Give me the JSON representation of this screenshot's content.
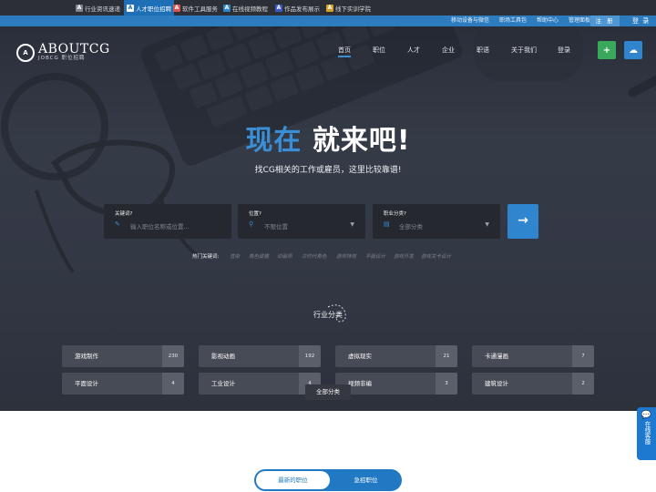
{
  "top_sites": [
    {
      "label": "行业资讯速递",
      "color": "#7d8591",
      "glyph": "A",
      "active": false
    },
    {
      "label": "人才职位招聘",
      "color": "#1d6fb8",
      "glyph": "A",
      "active": true
    },
    {
      "label": "软件工具服务",
      "color": "#d9534f",
      "glyph": "A",
      "active": false
    },
    {
      "label": "在线视频教程",
      "color": "#2e86c9",
      "glyph": "A",
      "active": false
    },
    {
      "label": "作品发布展示",
      "color": "#3b58c4",
      "glyph": "A",
      "active": false
    },
    {
      "label": "线下实训学院",
      "color": "#d6a12b",
      "glyph": "A",
      "active": false
    }
  ],
  "sub_links": [
    "移动设备与微信",
    "职场工具包",
    "帮助中心",
    "管理面板"
  ],
  "register_label": "注 册",
  "login_label": "登 录",
  "logo": {
    "title": "ABOUTCG",
    "subtitle": "JOBCG 职位招聘"
  },
  "nav": [
    {
      "label": "首页",
      "active": true
    },
    {
      "label": "职位",
      "active": false
    },
    {
      "label": "人才",
      "active": false
    },
    {
      "label": "企业",
      "active": false
    },
    {
      "label": "职语",
      "active": false
    },
    {
      "label": "关于我们",
      "active": false
    },
    {
      "label": "登录",
      "active": false
    }
  ],
  "header_buttons": [
    {
      "icon": "plus-icon",
      "glyph": "+",
      "color": "#3aa85a"
    },
    {
      "icon": "cloud-icon",
      "glyph": "☁",
      "color": "#2f86cf"
    }
  ],
  "hero": {
    "headline_blue": "现在",
    "headline_white": "就来吧!",
    "tagline": "找CG相关的工作或雇员，这里比较靠谱!"
  },
  "search": {
    "keyword": {
      "label": "关键词?",
      "placeholder": "输入职位名称或位置..."
    },
    "location": {
      "label": "位置?",
      "value": "不限位置"
    },
    "category": {
      "label": "职业分类?",
      "value": "全部分类"
    },
    "submit_icon": "arrow-right-icon"
  },
  "hot": {
    "label": "热门关键词:",
    "keywords": [
      "渲染",
      "角色建模",
      "动画师",
      "次时代角色",
      "游戏特效",
      "平面设计",
      "游戏开发",
      "游戏关卡设计"
    ]
  },
  "category_section": {
    "title": "行业分类",
    "categories": [
      {
        "name": "游戏制作",
        "count": "230"
      },
      {
        "name": "影视动画",
        "count": "192"
      },
      {
        "name": "虚拟现实",
        "count": "21"
      },
      {
        "name": "卡通漫画",
        "count": "7"
      },
      {
        "name": "平面设计",
        "count": "4"
      },
      {
        "name": "工业设计",
        "count": "4"
      },
      {
        "name": "视频非编",
        "count": "3"
      },
      {
        "name": "建筑设计",
        "count": "2"
      }
    ],
    "all_label": "全部分类"
  },
  "side_chat": {
    "label": "在线客服"
  },
  "tabs": [
    "最新的职位",
    "急招职位"
  ]
}
